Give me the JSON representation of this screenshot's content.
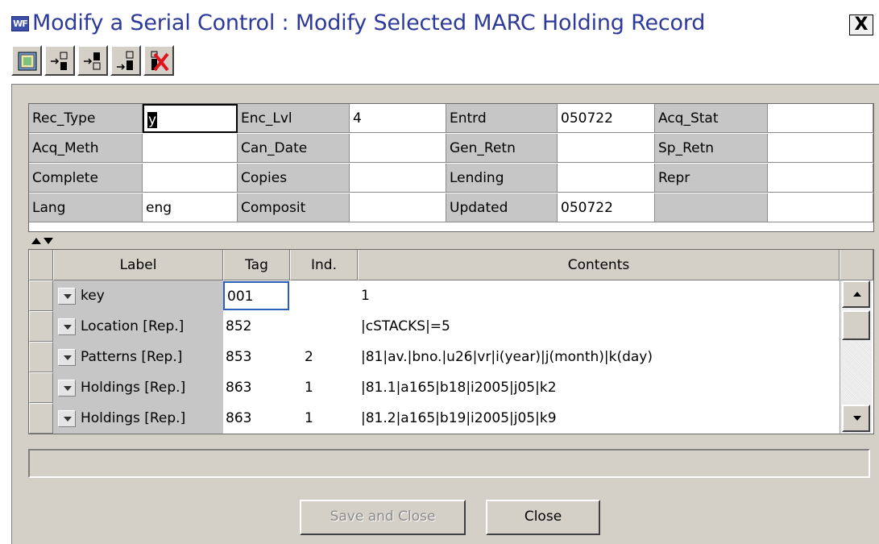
{
  "window": {
    "app_icon_text": "WF",
    "title": "Modify a Serial Control : Modify Selected MARC Holding Record",
    "close_glyph": "X"
  },
  "toolbar": {
    "buttons": [
      {
        "name": "record-view-icon"
      },
      {
        "name": "insert-field-before-icon"
      },
      {
        "name": "insert-field-after-icon"
      },
      {
        "name": "append-field-icon"
      },
      {
        "name": "delete-field-icon"
      }
    ]
  },
  "fixed_fields": {
    "rows": [
      [
        {
          "label": "Rec_Type",
          "value": "y"
        },
        {
          "label": "Enc_Lvl",
          "value": "4"
        },
        {
          "label": "Entrd",
          "value": "050722"
        },
        {
          "label": "Acq_Stat",
          "value": ""
        }
      ],
      [
        {
          "label": "Acq_Meth",
          "value": ""
        },
        {
          "label": "Can_Date",
          "value": ""
        },
        {
          "label": "Gen_Retn",
          "value": ""
        },
        {
          "label": "Sp_Retn",
          "value": ""
        }
      ],
      [
        {
          "label": "Complete",
          "value": ""
        },
        {
          "label": "Copies",
          "value": ""
        },
        {
          "label": "Lending",
          "value": ""
        },
        {
          "label": "Repr",
          "value": ""
        }
      ],
      [
        {
          "label": "Lang",
          "value": "eng"
        },
        {
          "label": "Composit",
          "value": ""
        },
        {
          "label": "Updated",
          "value": "050722"
        },
        {
          "label": "",
          "value": ""
        }
      ]
    ]
  },
  "variable_fields": {
    "columns": {
      "label": "Label",
      "tag": "Tag",
      "ind": "Ind.",
      "contents": "Contents"
    },
    "rows": [
      {
        "label": "key",
        "tag": "001",
        "ind": "",
        "contents": "1"
      },
      {
        "label": "Location [Rep.]",
        "tag": "852",
        "ind": "",
        "contents": "|cSTACKS|=5"
      },
      {
        "label": "Patterns [Rep.]",
        "tag": "853",
        "ind": "2",
        "contents": "|81|av.|bno.|u26|vr|i(year)|j(month)|k(day)"
      },
      {
        "label": "Holdings [Rep.]",
        "tag": "863",
        "ind": "1",
        "contents": "|81.1|a165|b18|i2005|j05|k2"
      },
      {
        "label": "Holdings [Rep.]",
        "tag": "863",
        "ind": "1",
        "contents": "|81.2|a165|b19|i2005|j05|k9"
      }
    ]
  },
  "buttons": {
    "save_close": "Save and Close",
    "close": "Close"
  },
  "colors": {
    "title": "#2e3a99",
    "dialog_bg": "#d4d0c8",
    "label_bg": "#c6c6c6",
    "delete_icon": "#e0141e"
  }
}
